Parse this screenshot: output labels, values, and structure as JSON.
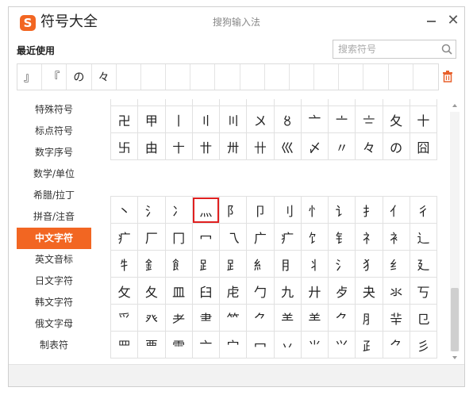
{
  "app": {
    "logo_char": "S",
    "title": "符号大全",
    "window_title": "搜狗输入法",
    "close_glyph": "✕"
  },
  "recent": {
    "label": "最近使用",
    "items": [
      "』",
      "『",
      "の",
      "々",
      "",
      "",
      "",
      "",
      "",
      "",
      "",
      "",
      "",
      "",
      "",
      "",
      ""
    ]
  },
  "search": {
    "placeholder": "搜索符号"
  },
  "sidebar": {
    "items": [
      {
        "label": "特殊符号"
      },
      {
        "label": "标点符号"
      },
      {
        "label": "数字序号"
      },
      {
        "label": "数学/单位"
      },
      {
        "label": "希腊/拉丁"
      },
      {
        "label": "拼音/注音"
      },
      {
        "label": "中文字符",
        "active": true
      },
      {
        "label": "英文音标"
      },
      {
        "label": "日文字符"
      },
      {
        "label": "韩文字符"
      },
      {
        "label": "俄文字母"
      },
      {
        "label": "制表符"
      }
    ]
  },
  "grid_top": {
    "rows": [
      [
        "ー",
        "ー",
        "ー",
        "ー",
        "ー",
        "ー",
        "ー",
        "ー",
        "ー",
        "ー",
        "ー",
        "ー"
      ],
      [
        "卍",
        "甲",
        "丨",
        "〢",
        "〣",
        "〤",
        "〥",
        "亠",
        "〦",
        "〧",
        "夂",
        "十"
      ],
      [
        "卐",
        "由",
        "〸",
        "〹",
        "〺",
        "卄",
        "巛",
        "〆",
        "〃",
        "々",
        "の",
        "囧"
      ]
    ]
  },
  "grid_bottom": {
    "rows": [
      [
        "丶",
        "氵",
        "冫",
        "灬",
        "阝",
        "卩",
        "刂",
        "忄",
        "讠",
        "扌",
        "亻",
        "彳"
      ],
      [
        "疒",
        "厂",
        "冂",
        "冖",
        "乁",
        "广",
        "疒",
        "饣",
        "钅",
        "礻",
        "衤",
        "辶"
      ],
      [
        "牜",
        "釒",
        "飠",
        "⻊",
        "⻊",
        "糹",
        "⺝",
        "丬",
        "氵",
        "犭",
        "纟",
        "廴"
      ],
      [
        "攵",
        "夂",
        "皿",
        "臼",
        "虍",
        "勹",
        "九",
        "廾",
        "歺",
        "夬",
        "氺",
        "丂"
      ],
      [
        "爫",
        "癶",
        "耂",
        "⺻",
        "⺮",
        "⺈",
        "⺷",
        "⺷",
        "⺈",
        "⺼",
        "⺸",
        "⺋"
      ],
      [
        "罒",
        "覀",
        "⻗",
        "亠",
        "宀",
        "冖",
        "丷",
        "⺌",
        "⺍",
        "⺪",
        "⺈",
        "彡"
      ]
    ],
    "selected": {
      "row": 0,
      "col": 3
    }
  }
}
